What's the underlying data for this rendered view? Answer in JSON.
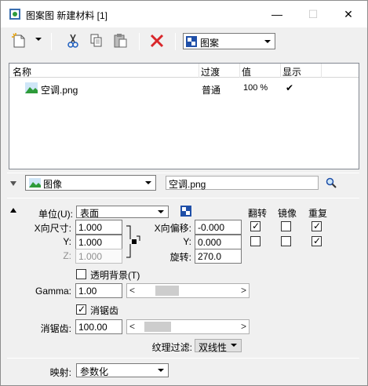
{
  "window": {
    "title": "图案图 新建材料 [1]",
    "minimize_glyph": "—",
    "maximize_glyph": "☐",
    "close_glyph": "✕"
  },
  "toolbar": {
    "icons": [
      "new-icon",
      "cut-icon",
      "copy-icon",
      "paste-icon",
      "delete-icon"
    ],
    "map_type_select": "图案"
  },
  "list": {
    "columns": [
      "名称",
      "过渡",
      "值",
      "显示"
    ],
    "rows": [
      {
        "name": "空调.png",
        "transition": "普通",
        "value": "100 %",
        "display": "✔"
      }
    ]
  },
  "map_source": {
    "type_select": "图像",
    "filename": "空调.png"
  },
  "params": {
    "units_label": "单位(U):",
    "units_value": "表面",
    "size_x_label": "X向尺寸:",
    "size_x": "1.000",
    "size_y_label": "Y:",
    "size_y": "1.000",
    "size_z_label": "Z:",
    "size_z": "1.000",
    "offset_x_label": "X向偏移:",
    "offset_x": "-0.000",
    "offset_y_label": "Y:",
    "offset_y": "0.000",
    "rotation_label": "旋转:",
    "rotation": "270.0",
    "flip_header": "翻转",
    "mirror_header": "镜像",
    "repeat_header": "重复",
    "flip_x": true,
    "mirror_x": false,
    "repeat_x": true,
    "flip_y": false,
    "mirror_y": false,
    "repeat_y": true,
    "transparent_bg_label": "透明背景(T)",
    "transparent_bg": false,
    "gamma_label": "Gamma:",
    "gamma": "1.00",
    "antialias_label": "消锯齿",
    "antialias": true,
    "antialias_value_label": "消锯齿:",
    "antialias_value": "100.00",
    "filter_label": "纹理过滤:",
    "filter_value": "双线性",
    "mapping_label": "映射:",
    "mapping_value": "参数化"
  },
  "colors": {
    "accent_red": "#d9262a",
    "image_green": "#2e9b3a",
    "sky_blue": "#7ec0ee"
  }
}
